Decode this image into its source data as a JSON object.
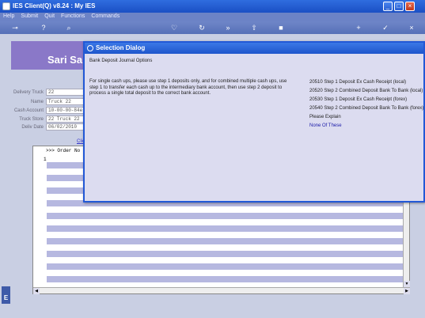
{
  "window": {
    "title": "IES Client(Q) v8.24 : My IES",
    "controls": [
      "_",
      "□",
      "×"
    ]
  },
  "menu": [
    "Help",
    "Submit",
    "Quit",
    "Functions",
    "Commands"
  ],
  "toolbar": {
    "icons": [
      "key-icon",
      "help-icon",
      "search-icon",
      "heart-icon",
      "refresh-icon",
      "rewind-icon",
      "fast-forward-icon",
      "upload-icon",
      "stop-icon",
      "add-icon",
      "check-icon",
      "close-icon"
    ]
  },
  "form": {
    "banner_text": "Sari Sar",
    "fields": [
      {
        "label": "Delivery Truck",
        "value": "22"
      },
      {
        "label": "Name",
        "value": "Truck 22"
      },
      {
        "label": "Cash Account",
        "value": "10-00-00-84e"
      },
      {
        "label": "Truck Store",
        "value": "22 Truck 22"
      },
      {
        "label": "Deliv Date",
        "value": "06/02/2010"
      }
    ],
    "link_fragment": "Clic"
  },
  "grid": {
    "header": ">>> Order No",
    "first_row_number": "1",
    "left_tab_letter": "E"
  },
  "dialog": {
    "title": "Selection Dialog",
    "subtitle": "Bank Deposit Journal Options",
    "instructions": "For single cash ups, please use step 1 deposits only, and for combined multiple cash ups, use step 1 to transfer each cash up to the intermediary bank account, then use step 2 deposit to process a single total deposit to the correct bank account.",
    "options": [
      {
        "label": "20510 Step 1 Deposit Ex Cash Receipt (local)",
        "accent": false
      },
      {
        "label": "20520 Step 2 Combined Deposit Bank To Bank (local)",
        "accent": false
      },
      {
        "label": "20530 Step 1 Deposit Ex Cash Receipt (forex)",
        "accent": false
      },
      {
        "label": "20540 Step 2 Combined Deposit Bank To Bank (forex)",
        "accent": false
      },
      {
        "label": "Please Explain",
        "accent": false
      },
      {
        "label": "None Of These",
        "accent": true
      }
    ]
  }
}
